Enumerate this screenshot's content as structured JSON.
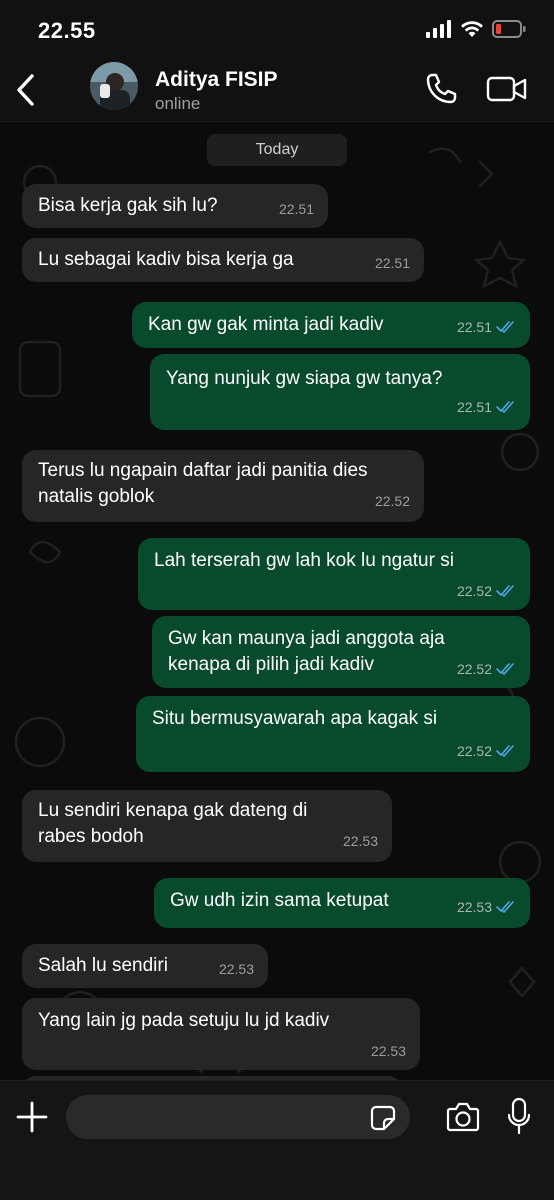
{
  "status_bar": {
    "time": "22.55"
  },
  "header": {
    "contact_name": "Aditya FISIP",
    "contact_status": "online"
  },
  "chat": {
    "date_label": "Today",
    "messages": [
      {
        "direction": "in",
        "text": "Bisa kerja gak sih lu?",
        "time": "22.51"
      },
      {
        "direction": "in",
        "text": "Lu sebagai kadiv bisa kerja ga",
        "time": "22.51"
      },
      {
        "direction": "out",
        "text": "Kan gw gak minta jadi kadiv",
        "time": "22.51",
        "status": "read"
      },
      {
        "direction": "out",
        "text": "Yang nunjuk gw siapa gw tanya?",
        "time": "22.51",
        "status": "read"
      },
      {
        "direction": "in",
        "text": "Terus lu ngapain daftar jadi panitia dies natalis goblok",
        "time": "22.52"
      },
      {
        "direction": "out",
        "text": "Lah terserah gw lah kok lu ngatur si",
        "time": "22.52",
        "status": "read"
      },
      {
        "direction": "out",
        "text": "Gw kan maunya jadi anggota aja kenapa di pilih jadi kadiv",
        "time": "22.52",
        "status": "read"
      },
      {
        "direction": "out",
        "text": "Situ bermusyawarah apa kagak si",
        "time": "22.52",
        "status": "read"
      },
      {
        "direction": "in",
        "text": "Lu sendiri kenapa gak dateng di rabes bodoh",
        "time": "22.53"
      },
      {
        "direction": "out",
        "text": "Gw udh izin sama ketupat",
        "time": "22.53",
        "status": "read"
      },
      {
        "direction": "in",
        "text": "Salah lu sendiri",
        "time": "22.53"
      },
      {
        "direction": "in",
        "text": "Yang lain jg pada setuju lu jd kadiv",
        "time": "22.53"
      }
    ]
  },
  "composer": {
    "input_value": "",
    "placeholder": ""
  },
  "colors": {
    "incoming_bubble": "#262626",
    "outgoing_bubble": "#074a2c",
    "read_tick": "#53a6e8",
    "background": "#0b0b0b"
  },
  "icons": {
    "back": "chevron-left-icon",
    "call": "phone-icon",
    "video": "video-camera-icon",
    "add": "plus-icon",
    "sticker": "sticker-icon",
    "camera": "camera-icon",
    "mic": "microphone-icon",
    "read": "double-check-icon"
  }
}
